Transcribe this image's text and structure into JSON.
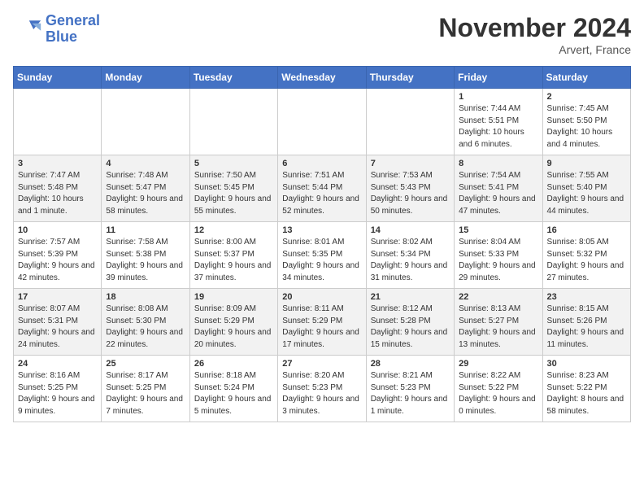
{
  "header": {
    "logo_line1": "General",
    "logo_line2": "Blue",
    "month_title": "November 2024",
    "location": "Arvert, France"
  },
  "weekdays": [
    "Sunday",
    "Monday",
    "Tuesday",
    "Wednesday",
    "Thursday",
    "Friday",
    "Saturday"
  ],
  "weeks": [
    [
      {
        "day": "",
        "info": ""
      },
      {
        "day": "",
        "info": ""
      },
      {
        "day": "",
        "info": ""
      },
      {
        "day": "",
        "info": ""
      },
      {
        "day": "",
        "info": ""
      },
      {
        "day": "1",
        "info": "Sunrise: 7:44 AM\nSunset: 5:51 PM\nDaylight: 10 hours and 6 minutes."
      },
      {
        "day": "2",
        "info": "Sunrise: 7:45 AM\nSunset: 5:50 PM\nDaylight: 10 hours and 4 minutes."
      }
    ],
    [
      {
        "day": "3",
        "info": "Sunrise: 7:47 AM\nSunset: 5:48 PM\nDaylight: 10 hours and 1 minute."
      },
      {
        "day": "4",
        "info": "Sunrise: 7:48 AM\nSunset: 5:47 PM\nDaylight: 9 hours and 58 minutes."
      },
      {
        "day": "5",
        "info": "Sunrise: 7:50 AM\nSunset: 5:45 PM\nDaylight: 9 hours and 55 minutes."
      },
      {
        "day": "6",
        "info": "Sunrise: 7:51 AM\nSunset: 5:44 PM\nDaylight: 9 hours and 52 minutes."
      },
      {
        "day": "7",
        "info": "Sunrise: 7:53 AM\nSunset: 5:43 PM\nDaylight: 9 hours and 50 minutes."
      },
      {
        "day": "8",
        "info": "Sunrise: 7:54 AM\nSunset: 5:41 PM\nDaylight: 9 hours and 47 minutes."
      },
      {
        "day": "9",
        "info": "Sunrise: 7:55 AM\nSunset: 5:40 PM\nDaylight: 9 hours and 44 minutes."
      }
    ],
    [
      {
        "day": "10",
        "info": "Sunrise: 7:57 AM\nSunset: 5:39 PM\nDaylight: 9 hours and 42 minutes."
      },
      {
        "day": "11",
        "info": "Sunrise: 7:58 AM\nSunset: 5:38 PM\nDaylight: 9 hours and 39 minutes."
      },
      {
        "day": "12",
        "info": "Sunrise: 8:00 AM\nSunset: 5:37 PM\nDaylight: 9 hours and 37 minutes."
      },
      {
        "day": "13",
        "info": "Sunrise: 8:01 AM\nSunset: 5:35 PM\nDaylight: 9 hours and 34 minutes."
      },
      {
        "day": "14",
        "info": "Sunrise: 8:02 AM\nSunset: 5:34 PM\nDaylight: 9 hours and 31 minutes."
      },
      {
        "day": "15",
        "info": "Sunrise: 8:04 AM\nSunset: 5:33 PM\nDaylight: 9 hours and 29 minutes."
      },
      {
        "day": "16",
        "info": "Sunrise: 8:05 AM\nSunset: 5:32 PM\nDaylight: 9 hours and 27 minutes."
      }
    ],
    [
      {
        "day": "17",
        "info": "Sunrise: 8:07 AM\nSunset: 5:31 PM\nDaylight: 9 hours and 24 minutes."
      },
      {
        "day": "18",
        "info": "Sunrise: 8:08 AM\nSunset: 5:30 PM\nDaylight: 9 hours and 22 minutes."
      },
      {
        "day": "19",
        "info": "Sunrise: 8:09 AM\nSunset: 5:29 PM\nDaylight: 9 hours and 20 minutes."
      },
      {
        "day": "20",
        "info": "Sunrise: 8:11 AM\nSunset: 5:29 PM\nDaylight: 9 hours and 17 minutes."
      },
      {
        "day": "21",
        "info": "Sunrise: 8:12 AM\nSunset: 5:28 PM\nDaylight: 9 hours and 15 minutes."
      },
      {
        "day": "22",
        "info": "Sunrise: 8:13 AM\nSunset: 5:27 PM\nDaylight: 9 hours and 13 minutes."
      },
      {
        "day": "23",
        "info": "Sunrise: 8:15 AM\nSunset: 5:26 PM\nDaylight: 9 hours and 11 minutes."
      }
    ],
    [
      {
        "day": "24",
        "info": "Sunrise: 8:16 AM\nSunset: 5:25 PM\nDaylight: 9 hours and 9 minutes."
      },
      {
        "day": "25",
        "info": "Sunrise: 8:17 AM\nSunset: 5:25 PM\nDaylight: 9 hours and 7 minutes."
      },
      {
        "day": "26",
        "info": "Sunrise: 8:18 AM\nSunset: 5:24 PM\nDaylight: 9 hours and 5 minutes."
      },
      {
        "day": "27",
        "info": "Sunrise: 8:20 AM\nSunset: 5:23 PM\nDaylight: 9 hours and 3 minutes."
      },
      {
        "day": "28",
        "info": "Sunrise: 8:21 AM\nSunset: 5:23 PM\nDaylight: 9 hours and 1 minute."
      },
      {
        "day": "29",
        "info": "Sunrise: 8:22 AM\nSunset: 5:22 PM\nDaylight: 9 hours and 0 minutes."
      },
      {
        "day": "30",
        "info": "Sunrise: 8:23 AM\nSunset: 5:22 PM\nDaylight: 8 hours and 58 minutes."
      }
    ]
  ]
}
